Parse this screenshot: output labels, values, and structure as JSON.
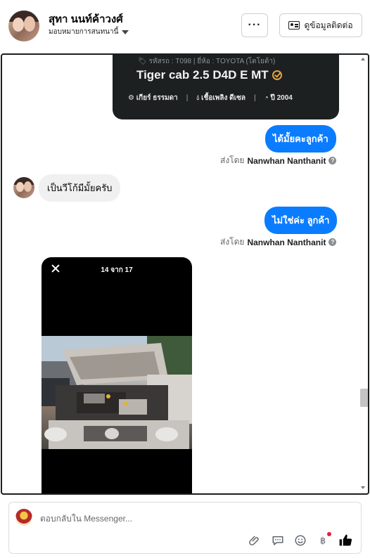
{
  "header": {
    "contact_name": "สุทา นนท์ค้าวงศ์",
    "assign_label": "มอบหมายการสนทนานี้",
    "more_label": "···",
    "view_contact_label": "ดูข้อมูลติดต่อ"
  },
  "car_card": {
    "code_line": "รหัสรถ : T098 | ยี่ห้อ : TOYOTA (โตโยต้า)",
    "model": "Tiger cab 2.5 D4D E MT",
    "gear": "เกียร์ ธรรมดา",
    "fuel": "เชื้อเพลิง ดีเซล",
    "year": "ปี 2004"
  },
  "messages": [
    {
      "direction": "out",
      "text": "ได้มั้ยคะลูกค้า",
      "sent_by_prefix": "ส่งโดย",
      "sent_by_name": "Nanwhan Nanthanit"
    },
    {
      "direction": "in",
      "text": "เป็นวีโก้มีมั้ยครับ"
    },
    {
      "direction": "out",
      "text": "ไม่ใช่ค่ะ ลูกค้า",
      "sent_by_prefix": "ส่งโดย",
      "sent_by_name": "Nanwhan Nanthanit"
    }
  ],
  "media_viewer": {
    "counter": "14 จาก 17"
  },
  "composer": {
    "placeholder": "ตอบกลับใน Messenger..."
  },
  "colors": {
    "outgoing_bubble": "#0a7cff",
    "incoming_bubble": "#f0f0f0",
    "card_bg": "#1d2021",
    "badge": "#e6a23c"
  }
}
